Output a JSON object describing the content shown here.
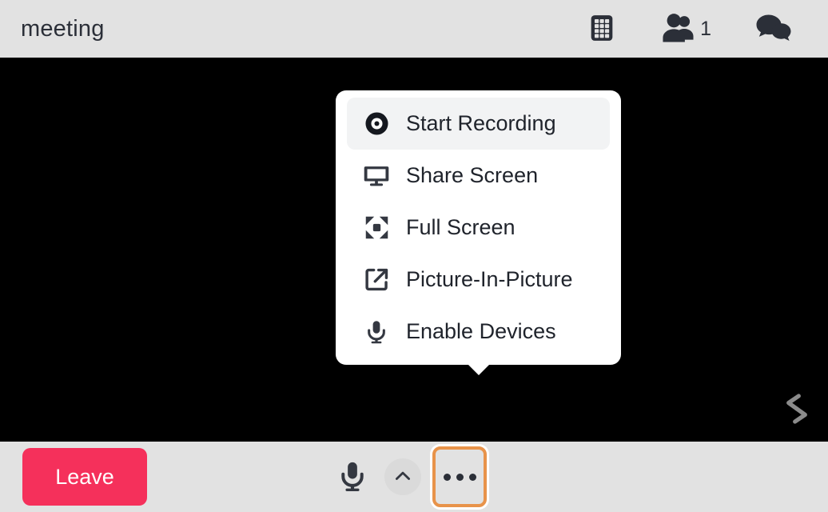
{
  "header": {
    "title": "meeting",
    "grid_icon": "grid-icon",
    "participants_icon": "people-icon",
    "participants_count": "1",
    "chat_icon": "chat-bubbles-icon"
  },
  "stage": {
    "watermark_icon": "brand-logo-watermark"
  },
  "menu": {
    "items": [
      {
        "label": "Start Recording",
        "icon": "record-icon",
        "active": true
      },
      {
        "label": "Share Screen",
        "icon": "monitor-icon",
        "active": false
      },
      {
        "label": "Full Screen",
        "icon": "expand-arrows-icon",
        "active": false
      },
      {
        "label": "Picture-In-Picture",
        "icon": "external-link-icon",
        "active": false
      },
      {
        "label": "Enable Devices",
        "icon": "microphone-icon",
        "active": false
      }
    ]
  },
  "bottombar": {
    "leave_label": "Leave",
    "mic_icon": "microphone-icon",
    "chevron_icon": "chevron-up-icon",
    "more_icon": "more-options-icon"
  },
  "colors": {
    "header_bg": "#e2e2e2",
    "stage_bg": "#000000",
    "menu_bg": "#ffffff",
    "menu_active_bg": "#f2f3f4",
    "text_dark": "#1f232b",
    "leave_red": "#f5305b",
    "focus_orange": "#e8934a"
  }
}
